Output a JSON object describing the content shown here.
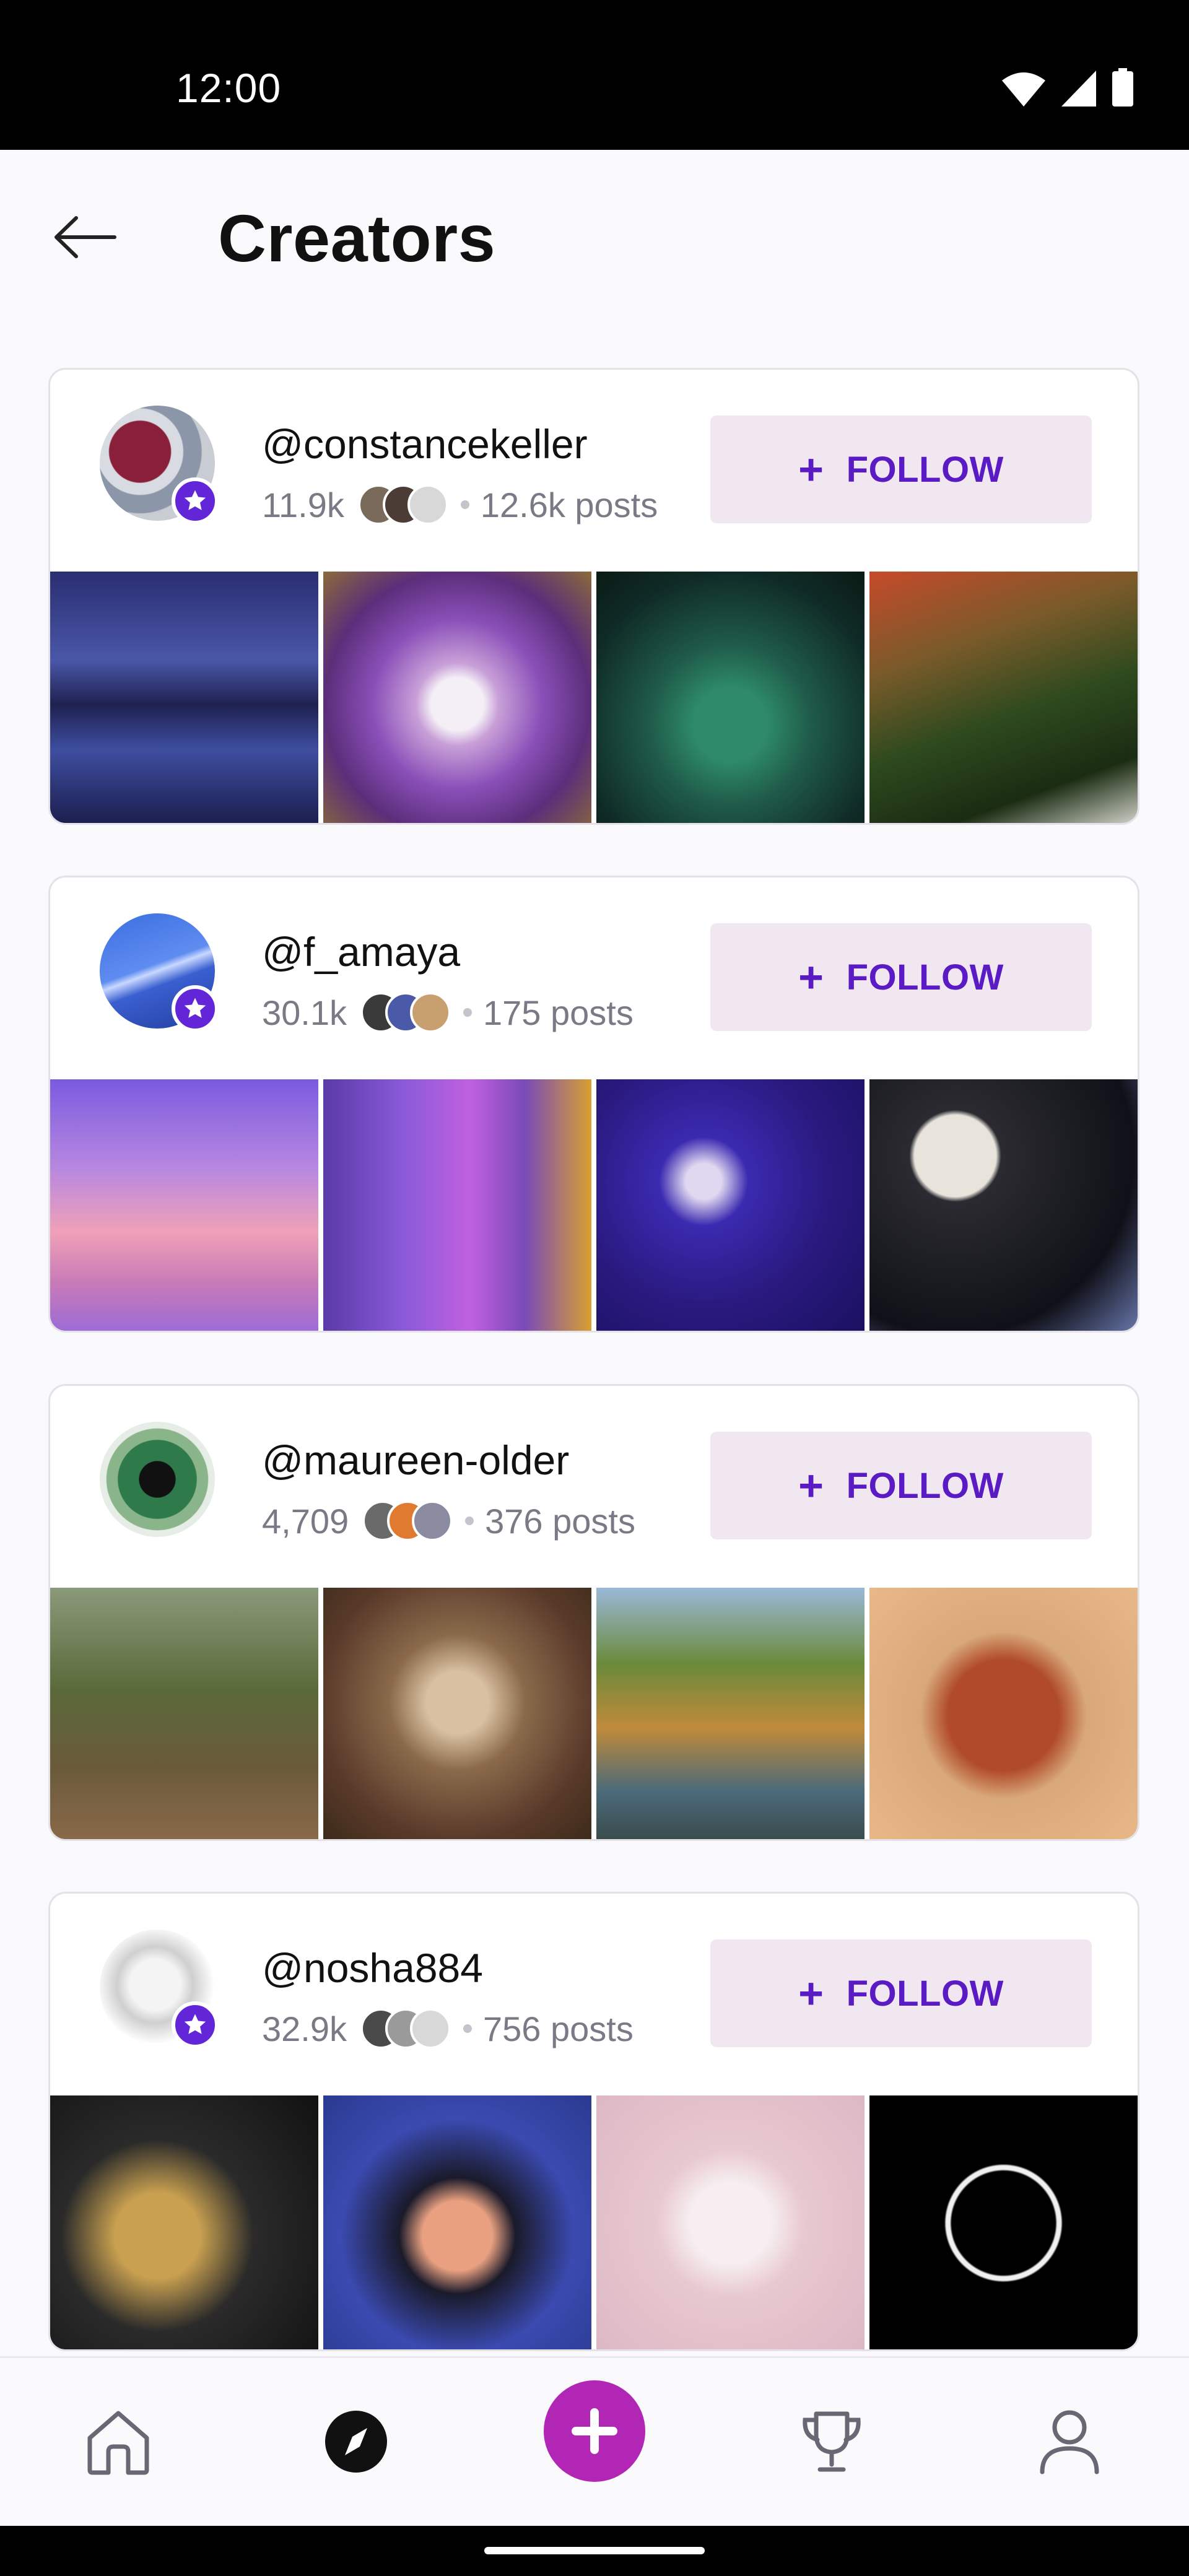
{
  "status_bar": {
    "time": "12:00"
  },
  "header": {
    "title": "Creators"
  },
  "creators": [
    {
      "username": "@constancekeller",
      "followers": "11.9k",
      "posts": "12.6k posts",
      "follow_label": "FOLLOW"
    },
    {
      "username": "@f_amaya",
      "followers": "30.1k",
      "posts": "175 posts",
      "follow_label": "FOLLOW"
    },
    {
      "username": "@maureen-older",
      "followers": "4,709",
      "posts": "376 posts",
      "follow_label": "FOLLOW"
    },
    {
      "username": "@nosha884",
      "followers": "32.9k",
      "posts": "756 posts",
      "follow_label": "FOLLOW"
    }
  ],
  "bottom_nav": {
    "items": [
      "home-icon",
      "explore-icon",
      "create-icon",
      "trophy-icon",
      "profile-icon"
    ],
    "selected": "explore-icon"
  },
  "colors": {
    "accent": "#5a1bc4",
    "follow_bg": "#f1e7f1",
    "create_button": "#b126b5",
    "badge": "#6225d8"
  }
}
